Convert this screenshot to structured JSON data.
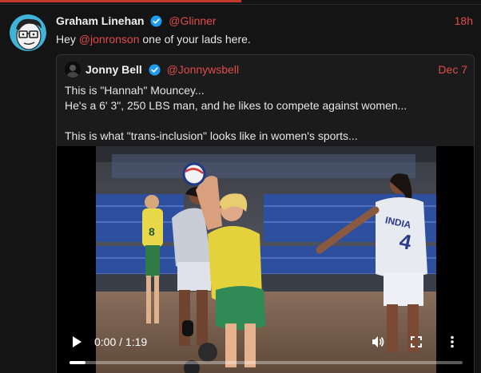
{
  "tweet": {
    "author_name": "Graham Linehan",
    "author_handle": "@Glinner",
    "time": "18h",
    "text_prefix": "Hey ",
    "mention": "@jonronson",
    "text_suffix": " one of your lads here."
  },
  "quoted_tweet": {
    "author_name": "Jonny Bell",
    "author_handle": "@Jonnywsbell",
    "time": "Dec 7",
    "lines": [
      "This is \"Hannah\" Mouncey...",
      "He's a 6' 3\", 250 LBS man, and he likes to compete against women...",
      "",
      "This is what \"trans-inclusion\" looks like in women's sports..."
    ]
  },
  "video": {
    "time_display": "0:00 / 1:19",
    "progress_fraction": 0.04,
    "jersey_text": "INDIA",
    "jersey_number": "4",
    "icons": [
      "play-icon",
      "volume-icon",
      "fullscreen-icon",
      "more-options-icon"
    ]
  },
  "colors": {
    "accent": "#e24b4b",
    "verified": "#1d9bf0",
    "background": "#141414"
  }
}
